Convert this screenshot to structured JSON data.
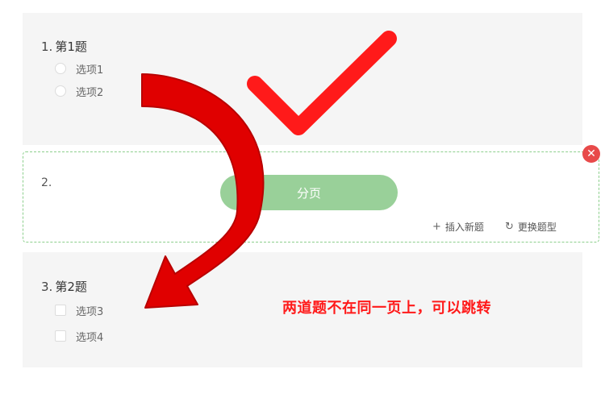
{
  "question1": {
    "number": "1.",
    "title": "第1题",
    "options": [
      "选项1",
      "选项2"
    ]
  },
  "pagebreak": {
    "number": "2.",
    "button_label": "分页",
    "insert_label": "插入新题",
    "change_label": "更换题型"
  },
  "question3": {
    "number": "3.",
    "title": "第2题",
    "options": [
      "选项3",
      "选项4"
    ]
  },
  "annotation": {
    "text": "两道题不在同一页上，可以跳转",
    "color": "#ff1a1a"
  },
  "colors": {
    "accent_green": "#99d099",
    "dashed_border": "#8ccf8c",
    "close_red": "#e84a4a",
    "card_bg": "#f5f5f5"
  },
  "icons": {
    "close": "close-icon",
    "insert": "plus-icon",
    "change": "swap-icon"
  }
}
